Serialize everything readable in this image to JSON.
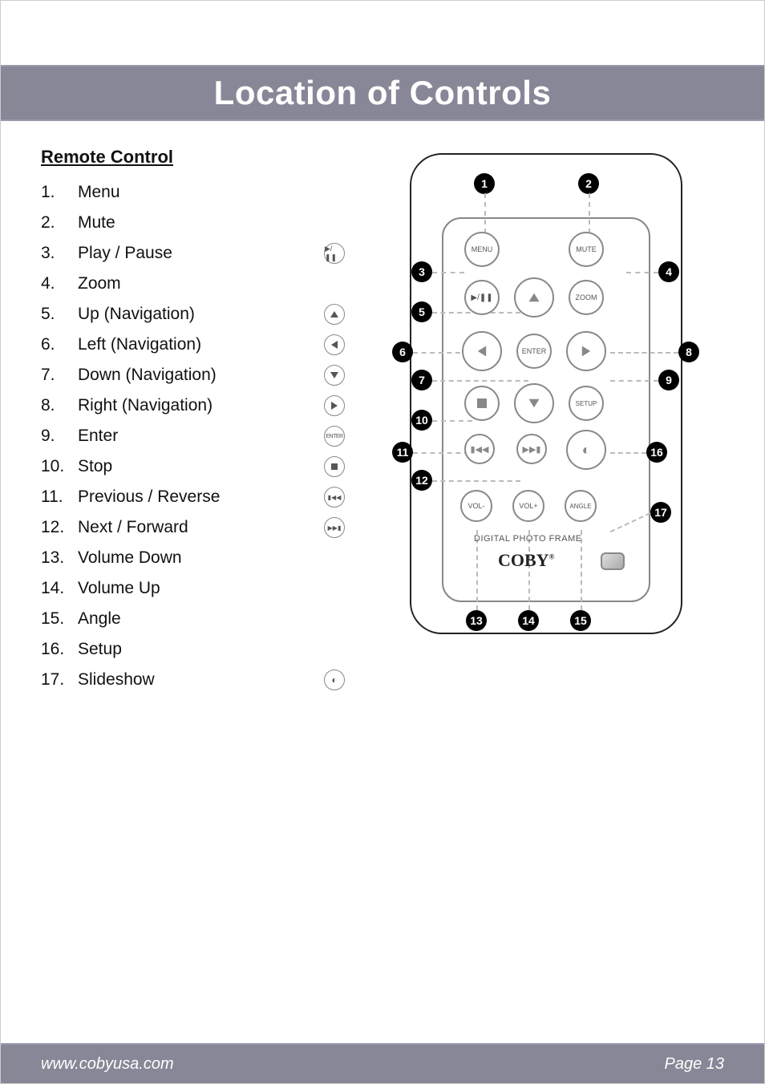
{
  "page_title": "Location of Controls",
  "section_heading": "Remote Control",
  "controls": [
    {
      "num": "1.",
      "label": "Menu",
      "icon": null
    },
    {
      "num": "2.",
      "label": "Mute",
      "icon": null
    },
    {
      "num": "3.",
      "label": "Play / Pause",
      "icon": "play-pause"
    },
    {
      "num": "4.",
      "label": "Zoom",
      "icon": null
    },
    {
      "num": "5.",
      "label": "Up (Navigation)",
      "icon": "up"
    },
    {
      "num": "6.",
      "label": "Left (Navigation)",
      "icon": "left"
    },
    {
      "num": "7.",
      "label": "Down (Navigation)",
      "icon": "down"
    },
    {
      "num": "8.",
      "label": "Right (Navigation)",
      "icon": "right"
    },
    {
      "num": "9.",
      "label": "Enter",
      "icon": "enter"
    },
    {
      "num": "10.",
      "label": "Stop",
      "icon": "stop"
    },
    {
      "num": "11.",
      "label": "Previous / Reverse",
      "icon": "prev"
    },
    {
      "num": "12.",
      "label": "Next / Forward",
      "icon": "next"
    },
    {
      "num": "13.",
      "label": "Volume Down",
      "icon": null
    },
    {
      "num": "14.",
      "label": "Volume Up",
      "icon": null
    },
    {
      "num": "15.",
      "label": "Angle",
      "icon": null
    },
    {
      "num": "16.",
      "label": "Setup",
      "icon": null
    },
    {
      "num": "17.",
      "label": "Slideshow",
      "icon": "slideshow"
    }
  ],
  "remote_buttons": {
    "menu": "MENU",
    "mute": "MUTE",
    "zoom": "ZOOM",
    "enter": "ENTER",
    "setup": "SETUP",
    "vol_minus": "VOL-",
    "vol_plus": "VOL+",
    "angle": "ANGLE",
    "dpf_text": "DIGITAL PHOTO FRAME",
    "brand": "COBY"
  },
  "footer": {
    "url": "www.cobyusa.com",
    "page": "Page 13"
  }
}
